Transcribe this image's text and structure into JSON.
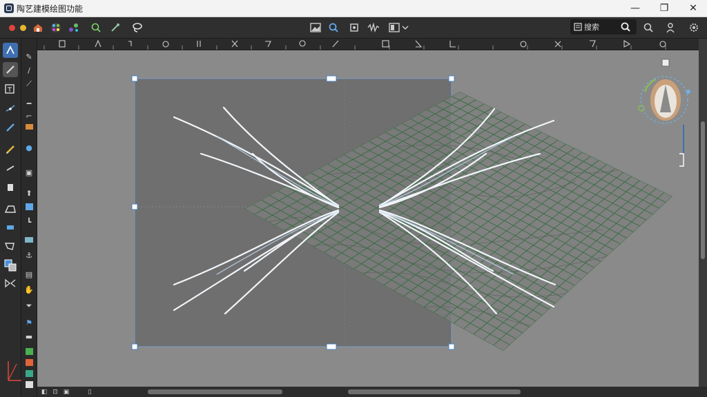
{
  "window": {
    "title": "陶艺建模绘图功能",
    "minimize_glyph": "—",
    "maximize_glyph": "❐",
    "close_glyph": "✕"
  },
  "toolbar": {
    "search_label": "搜索",
    "accent": "#3f6fb0"
  },
  "canvas": {
    "background": "#8a8a8a",
    "selection_fill": "#6f6f6f",
    "grid_color": "#2f6b3a",
    "fiber_color": "#f2f6fa"
  },
  "icons": {
    "left_tools": [
      "navigate-icon",
      "brush-icon",
      "text-frame-icon",
      "path-icon",
      "pen-icon",
      "pencil-icon",
      "knife-icon",
      "fill-icon",
      "shape-icon",
      "speech-bubble-icon",
      "color-swatch-icon",
      "transform-icon"
    ],
    "view_tools": [
      "image-view-icon",
      "zoom-icon",
      "crop-icon",
      "waveform-icon",
      "layout-icon"
    ],
    "right_tools": [
      "zoom-search-icon",
      "user-icon",
      "settings-icon"
    ]
  }
}
